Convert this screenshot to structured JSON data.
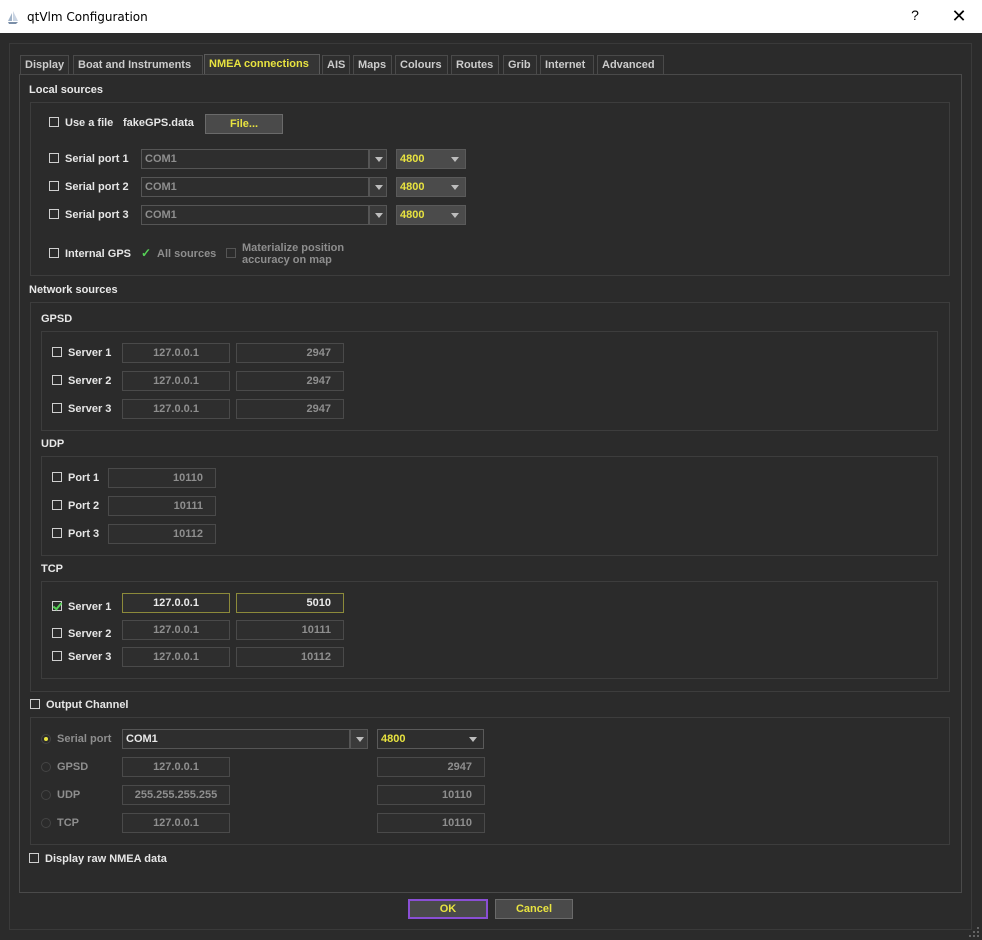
{
  "window": {
    "title": "qtVlm Configuration",
    "help": "?",
    "close": "✕"
  },
  "tabs": [
    {
      "label": "Display"
    },
    {
      "label": "Boat and Instruments"
    },
    {
      "label": "NMEA connections"
    },
    {
      "label": "AIS"
    },
    {
      "label": "Maps"
    },
    {
      "label": "Colours"
    },
    {
      "label": "Routes"
    },
    {
      "label": "Grib"
    },
    {
      "label": "Internet"
    },
    {
      "label": "Advanced"
    }
  ],
  "local": {
    "title": "Local sources",
    "use_file": {
      "label": "Use a file",
      "filename": "fakeGPS.data",
      "button": "File..."
    },
    "serial": [
      {
        "label": "Serial port 1",
        "port": "COM1",
        "baud": "4800"
      },
      {
        "label": "Serial port 2",
        "port": "COM1",
        "baud": "4800"
      },
      {
        "label": "Serial port 3",
        "port": "COM1",
        "baud": "4800"
      }
    ],
    "internal_gps": {
      "label": "Internal GPS",
      "all_sources": "All sources",
      "materialize": [
        "Materialize position",
        "accuracy on map"
      ]
    }
  },
  "network": {
    "title": "Network sources",
    "gpsd": {
      "title": "GPSD",
      "rows": [
        {
          "label": "Server 1",
          "host": "127.0.0.1",
          "port": "2947"
        },
        {
          "label": "Server 2",
          "host": "127.0.0.1",
          "port": "2947"
        },
        {
          "label": "Server 3",
          "host": "127.0.0.1",
          "port": "2947"
        }
      ]
    },
    "udp": {
      "title": "UDP",
      "rows": [
        {
          "label": "Port 1",
          "port": "10110"
        },
        {
          "label": "Port 2",
          "port": "10111"
        },
        {
          "label": "Port 3",
          "port": "10112"
        }
      ]
    },
    "tcp": {
      "title": "TCP",
      "rows": [
        {
          "label": "Server 1",
          "host": "127.0.0.1",
          "port": "5010"
        },
        {
          "label": "Server 2",
          "host": "127.0.0.1",
          "port": "10111"
        },
        {
          "label": "Server 3",
          "host": "127.0.0.1",
          "port": "10112"
        }
      ]
    }
  },
  "output": {
    "label": "Output Channel",
    "serial": {
      "label": "Serial port",
      "port": "COM1",
      "baud": "4800"
    },
    "gpsd": {
      "label": "GPSD",
      "host": "127.0.0.1",
      "port": "2947"
    },
    "udp": {
      "label": "UDP",
      "host": "255.255.255.255",
      "port": "10110"
    },
    "tcp": {
      "label": "TCP",
      "host": "127.0.0.1",
      "port": "10110"
    }
  },
  "raw": {
    "label": "Display raw NMEA data"
  },
  "buttons": {
    "ok": "OK",
    "cancel": "Cancel"
  },
  "colors": {
    "accent": "#e8e340",
    "check": "#56d156",
    "ok_border": "#8a4fd4"
  }
}
